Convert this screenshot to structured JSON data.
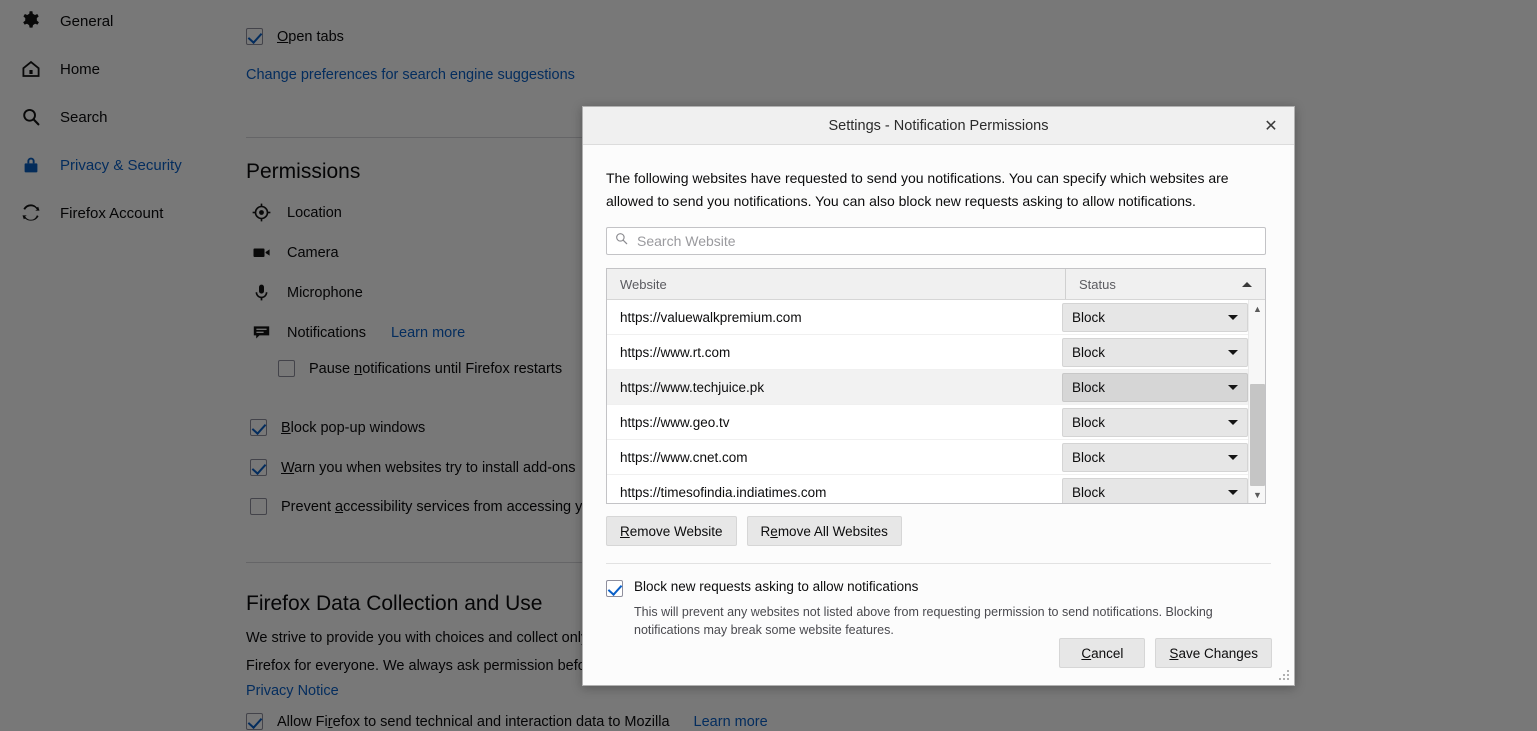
{
  "sidebar": {
    "items": [
      {
        "label": "General",
        "icon": "gear-icon",
        "active": false
      },
      {
        "label": "Home",
        "icon": "home-icon",
        "active": false
      },
      {
        "label": "Search",
        "icon": "search-icon",
        "active": false
      },
      {
        "label": "Privacy & Security",
        "icon": "lock-icon",
        "active": true
      },
      {
        "label": "Firefox Account",
        "icon": "sync-icon",
        "active": false
      }
    ]
  },
  "background": {
    "open_tabs_label": "Open tabs",
    "search_prefs_link": "Change preferences for search engine suggestions",
    "permissions_heading": "Permissions",
    "permissions": [
      {
        "label": "Location",
        "icon": "location-icon"
      },
      {
        "label": "Camera",
        "icon": "camera-icon"
      },
      {
        "label": "Microphone",
        "icon": "microphone-icon"
      },
      {
        "label": "Notifications",
        "icon": "notification-icon"
      }
    ],
    "notifications_learn_more": "Learn more",
    "pause_notifications_label": "Pause notifications until Firefox restarts",
    "block_popups_label": "Block pop-up windows",
    "warn_addons_label": "Warn you when websites try to install add-ons",
    "prevent_a11y_label": "Prevent accessibility services from accessing your browser",
    "data_heading": "Firefox Data Collection and Use",
    "data_para_line1": "We strive to provide you with choices and collect only what we need to provide and improve",
    "data_para_line2": "Firefox for everyone. We always ask permission before receiving personal information.",
    "privacy_notice_link": "Privacy Notice",
    "telemetry_label": "Allow Firefox to send technical and interaction data to Mozilla",
    "telemetry_learn_more": "Learn more"
  },
  "dialog": {
    "title": "Settings - Notification Permissions",
    "close_icon": "✕",
    "intro": "The following websites have requested to send you notifications. You can specify which websites are allowed to send you notifications. You can also block new requests asking to allow notifications.",
    "search": {
      "placeholder": "Search Website",
      "value": "",
      "icon": "search-icon"
    },
    "table": {
      "columns": [
        "Website",
        "Status"
      ],
      "sort_column": "Status",
      "sort_direction": "ascending",
      "rows": [
        {
          "website": "https://valuewalkpremium.com",
          "status": "Block",
          "selected": false
        },
        {
          "website": "https://www.rt.com",
          "status": "Block",
          "selected": false
        },
        {
          "website": "https://www.techjuice.pk",
          "status": "Block",
          "selected": true
        },
        {
          "website": "https://www.geo.tv",
          "status": "Block",
          "selected": false
        },
        {
          "website": "https://www.cnet.com",
          "status": "Block",
          "selected": false
        },
        {
          "website": "https://timesofindia.indiatimes.com",
          "status": "Block",
          "selected": false
        }
      ]
    },
    "remove_website_label": "Remove Website",
    "remove_all_label": "Remove All Websites",
    "block_new_label": "Block new requests asking to allow notifications",
    "block_new_desc": "This will prevent any websites not listed above from requesting permission to send notifications. Blocking notifications may break some website features.",
    "block_new_checked": true,
    "cancel_label": "Cancel",
    "save_label": "Save Changes"
  },
  "colors": {
    "accent": "#0a60c8",
    "backdrop": "#757575",
    "dialog_titlebar": "#f0f0f0",
    "selected_row": "#f2f2f2"
  }
}
